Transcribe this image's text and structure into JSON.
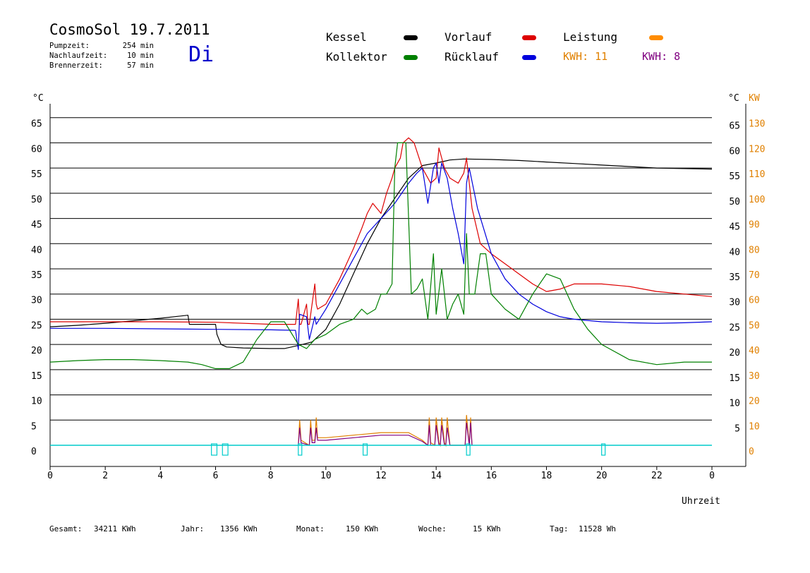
{
  "header": {
    "title": "CosmoSol 19.7.2011",
    "day": "Di",
    "stats": [
      {
        "label": "Pumpzeit:",
        "value": "254 min"
      },
      {
        "label": "Nachlaufzeit:",
        "value": "10 min"
      },
      {
        "label": "Brennerzeit:",
        "value": "57 min"
      }
    ]
  },
  "legend": {
    "items": [
      {
        "name": "Kessel",
        "color": "#000000"
      },
      {
        "name": "Kollektor",
        "color": "#008000"
      },
      {
        "name": "Vorlauf",
        "color": "#dd0000"
      },
      {
        "name": "Rücklauf",
        "color": "#0000dd"
      },
      {
        "name": "Leistung",
        "color": "#ff8c00"
      }
    ],
    "kwh_orange": {
      "text": "KWH: 11",
      "color": "#e08000"
    },
    "kwh_purple": {
      "text": "KWH: 8",
      "color": "#800080"
    }
  },
  "axes": {
    "left_unit": "°C",
    "right_unit_temp": "°C",
    "right_unit_power": "KW",
    "xlabel": "Uhrzeit",
    "power_color": "#e08000"
  },
  "footer": [
    {
      "label": "Gesamt:",
      "value": "34211 KWh"
    },
    {
      "label": "Jahr:",
      "value": "1356 KWh"
    },
    {
      "label": "Monat:",
      "value": "150 KWh"
    },
    {
      "label": "Woche:",
      "value": "15 KWh"
    },
    {
      "label": "Tag:",
      "value": "11528 Wh"
    }
  ],
  "chart_data": {
    "type": "line",
    "x_unit": "hour",
    "xlim": [
      0,
      24
    ],
    "x_ticks": [
      0,
      2,
      4,
      6,
      8,
      10,
      12,
      14,
      16,
      18,
      20,
      22,
      24
    ],
    "x_tick_labels": [
      "0",
      "2",
      "4",
      "6",
      "8",
      "10",
      "12",
      "14",
      "16",
      "18",
      "20",
      "22",
      "0"
    ],
    "ylim": [
      0,
      70
    ],
    "y_ticks": [
      0,
      5,
      10,
      15,
      20,
      25,
      30,
      35,
      40,
      45,
      50,
      55,
      60,
      65
    ],
    "y_tick_labels": [
      "0",
      "5",
      "10",
      "15",
      "20",
      "25",
      "30",
      "35",
      "40",
      "45",
      "50",
      "55",
      "60",
      "65"
    ],
    "y_tick_labels_right": [
      "",
      "5",
      "10",
      "15",
      "20",
      "25",
      "30",
      "35",
      "40",
      "45",
      "50",
      "55",
      "60",
      "65"
    ],
    "y2lim": [
      0,
      140
    ],
    "y2_ticks": [
      0,
      10,
      20,
      30,
      40,
      50,
      60,
      70,
      80,
      90,
      100,
      110,
      120,
      130
    ],
    "y2_tick_labels": [
      "0",
      "10",
      "20",
      "30",
      "40",
      "50",
      "60",
      "70",
      "80",
      "90",
      "100",
      "110",
      "120",
      "130"
    ],
    "grid": true,
    "series": [
      {
        "name": "Kessel",
        "color": "#000000",
        "x": [
          0,
          1,
          2,
          3,
          4,
          5,
          5.05,
          6,
          6.05,
          6.2,
          6.4,
          7,
          8,
          8.5,
          9,
          9.5,
          10,
          10.5,
          11,
          11.5,
          12,
          12.5,
          13,
          13.5,
          14,
          14.5,
          15,
          16,
          17,
          18,
          19,
          20,
          21,
          22,
          23,
          24
        ],
        "y": [
          23.5,
          23.8,
          24.2,
          24.7,
          25.2,
          25.8,
          24,
          24,
          22,
          20,
          19.5,
          19.3,
          19.2,
          19.2,
          19.8,
          20.5,
          23,
          28,
          34,
          40,
          45,
          49,
          53,
          55.5,
          56,
          56.6,
          56.8,
          56.7,
          56.5,
          56.2,
          55.9,
          55.6,
          55.3,
          55,
          54.9,
          54.8
        ]
      },
      {
        "name": "Vorlauf",
        "color": "#dd0000",
        "x": [
          0,
          2,
          4,
          6,
          8,
          8.9,
          9,
          9.05,
          9.1,
          9.3,
          9.35,
          9.4,
          9.6,
          9.65,
          9.7,
          10,
          10.5,
          11,
          11.3,
          11.5,
          11.7,
          12,
          12.2,
          12.4,
          12.5,
          12.7,
          12.8,
          13,
          13.2,
          13.5,
          13.8,
          14,
          14.1,
          14.3,
          14.5,
          14.8,
          15,
          15.1,
          15.3,
          15.6,
          16,
          16.5,
          17,
          17.5,
          18,
          18.5,
          19,
          20,
          21,
          22,
          23,
          24
        ],
        "y": [
          24.5,
          24.5,
          24.5,
          24.4,
          24,
          24,
          29,
          24,
          24,
          28,
          24,
          24,
          32,
          28,
          27,
          28,
          33,
          39,
          43,
          46,
          48,
          46,
          50,
          53,
          55,
          57,
          60,
          61,
          60,
          55,
          52,
          53,
          59,
          55,
          53,
          52,
          54,
          57,
          47,
          40,
          38,
          36,
          34,
          32,
          30.5,
          31,
          32,
          32,
          31.5,
          30.5,
          30,
          29.5
        ]
      },
      {
        "name": "Rücklauf",
        "color": "#0000dd",
        "x": [
          0,
          2,
          4,
          6,
          8,
          8.9,
          9,
          9.05,
          9.3,
          9.4,
          9.6,
          9.65,
          10,
          10.5,
          11,
          11.5,
          12,
          12.5,
          13,
          13.3,
          13.5,
          13.7,
          13.9,
          14,
          14.1,
          14.2,
          14.4,
          14.6,
          14.8,
          15,
          15.1,
          15.2,
          15.5,
          16,
          16.5,
          17,
          17.5,
          18,
          18.5,
          19,
          20,
          21,
          22,
          23,
          24
        ],
        "y": [
          23.2,
          23.2,
          23.1,
          23,
          22.9,
          22.8,
          19,
          26,
          25.5,
          21,
          25.5,
          24,
          27,
          32,
          37,
          42,
          45,
          48,
          52,
          54,
          55,
          48,
          55,
          56,
          52,
          56,
          53,
          47,
          42,
          36,
          52,
          55,
          47,
          38,
          33,
          30,
          28,
          26.5,
          25.5,
          25,
          24.5,
          24.3,
          24.2,
          24.3,
          24.5
        ]
      },
      {
        "name": "Kollektor",
        "color": "#008000",
        "x": [
          0,
          1,
          2,
          3,
          4,
          5,
          5.5,
          6,
          6.5,
          7,
          7.5,
          8,
          8.5,
          9,
          9.3,
          9.6,
          10,
          10.5,
          11,
          11.3,
          11.5,
          11.8,
          12,
          12.2,
          12.4,
          12.5,
          12.6,
          12.9,
          13.1,
          13.3,
          13.5,
          13.7,
          13.9,
          14,
          14.2,
          14.4,
          14.6,
          14.8,
          15,
          15.1,
          15.2,
          15.4,
          15.6,
          15.8,
          16,
          16.5,
          17,
          17.5,
          18,
          18.5,
          19,
          19.5,
          20,
          21,
          22,
          23,
          24
        ],
        "y": [
          16.5,
          16.8,
          17,
          17,
          16.8,
          16.5,
          16,
          15.2,
          15.2,
          16.5,
          21,
          24.5,
          24.5,
          20,
          19.2,
          21,
          22,
          24,
          25,
          27,
          26,
          27,
          30,
          30,
          32,
          55,
          60,
          60,
          30,
          31,
          33,
          25,
          38,
          26,
          35,
          25,
          28,
          30,
          26,
          42,
          30,
          30,
          38,
          38,
          30,
          27,
          25,
          30,
          34,
          33,
          27,
          23,
          20,
          17,
          16,
          16.5,
          16.5
        ]
      }
    ],
    "power_series": [
      {
        "name": "Leistung",
        "color": "#e08000",
        "axis": "right",
        "x": [
          9,
          9.05,
          9.1,
          9.4,
          9.45,
          9.5,
          9.6,
          9.65,
          9.7,
          10,
          11,
          12,
          13,
          13.5,
          13.7,
          13.75,
          13.8,
          13.95,
          14,
          14.1,
          14.15,
          14.2,
          14.3,
          14.35,
          14.4,
          14.5,
          15.05,
          15.1,
          15.2,
          15.25,
          15.3
        ],
        "y": [
          0,
          10,
          2,
          0,
          10,
          2,
          2,
          11,
          3,
          3,
          4,
          5,
          5,
          2,
          0,
          11,
          1,
          0,
          11,
          1,
          0,
          11,
          1,
          0,
          11,
          0,
          0,
          12,
          0,
          11,
          0
        ]
      },
      {
        "name": "Leistung 2",
        "color": "#800080",
        "axis": "right",
        "x": [
          9,
          9.05,
          9.1,
          9.4,
          9.45,
          9.5,
          9.6,
          9.65,
          9.7,
          10,
          11,
          12,
          13,
          13.5,
          13.7,
          13.75,
          13.8,
          13.95,
          14,
          14.1,
          14.15,
          14.2,
          14.3,
          14.35,
          14.4,
          14.5,
          15.05,
          15.1,
          15.2,
          15.25,
          15.3
        ],
        "y": [
          0,
          7,
          1,
          0,
          7,
          1,
          1,
          7,
          2,
          2,
          3,
          4,
          4,
          1.5,
          0,
          8,
          0,
          0,
          8,
          0,
          0,
          8,
          0,
          0,
          7,
          0,
          0,
          9,
          0,
          9,
          0
        ]
      }
    ],
    "pump_markers": [
      {
        "start": 5.85,
        "end": 6.05
      },
      {
        "start": 6.25,
        "end": 6.45
      },
      {
        "start": 9.0,
        "end": 9.1
      },
      {
        "start": 11.35,
        "end": 11.5
      },
      {
        "start": 15.1,
        "end": 15.2
      },
      {
        "start": 20.0,
        "end": 20.1
      }
    ],
    "pump_color": "#00cccc"
  }
}
